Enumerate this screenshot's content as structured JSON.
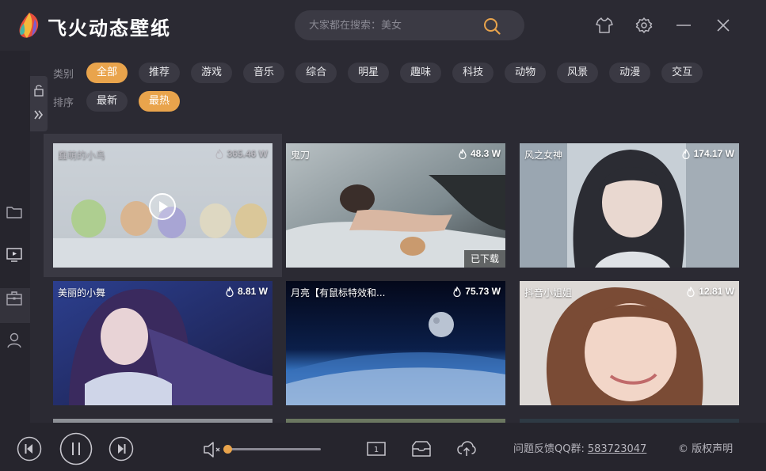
{
  "app": {
    "title": "飞火动态壁纸"
  },
  "search": {
    "placeholder": "大家都在搜索：美女"
  },
  "filters": {
    "category_label": "类别",
    "categories": [
      "全部",
      "推荐",
      "游戏",
      "音乐",
      "综合",
      "明星",
      "趣味",
      "科技",
      "动物",
      "风景",
      "动漫",
      "交互"
    ],
    "active_category": "全部",
    "sort_label": "排序",
    "sorts": [
      "最新",
      "最热"
    ],
    "active_sort": "最热"
  },
  "wallpapers": [
    {
      "title": "蠢萌的小鸟",
      "hot": "365.46 W",
      "downloaded": "",
      "type": "video"
    },
    {
      "title": "鬼刀",
      "hot": "48.3 W",
      "downloaded": "已下载"
    },
    {
      "title": "风之女神",
      "hot": "174.17 W",
      "downloaded": ""
    },
    {
      "title": "美丽的小舞",
      "hot": "8.81 W",
      "downloaded": ""
    },
    {
      "title": "月亮【有鼠标特效和...",
      "hot": "75.73 W",
      "downloaded": ""
    },
    {
      "title": "抖音小姐姐",
      "hot": "12.81 W",
      "downloaded": ""
    }
  ],
  "footer": {
    "feedback_label": "问题反馈QQ群:",
    "qq_group": "583723047",
    "copyright": "© 版权声明",
    "volume": 0.0
  },
  "colors": {
    "accent": "#e9a44c",
    "background": "#2b2a33",
    "chip": "#3a3943"
  }
}
